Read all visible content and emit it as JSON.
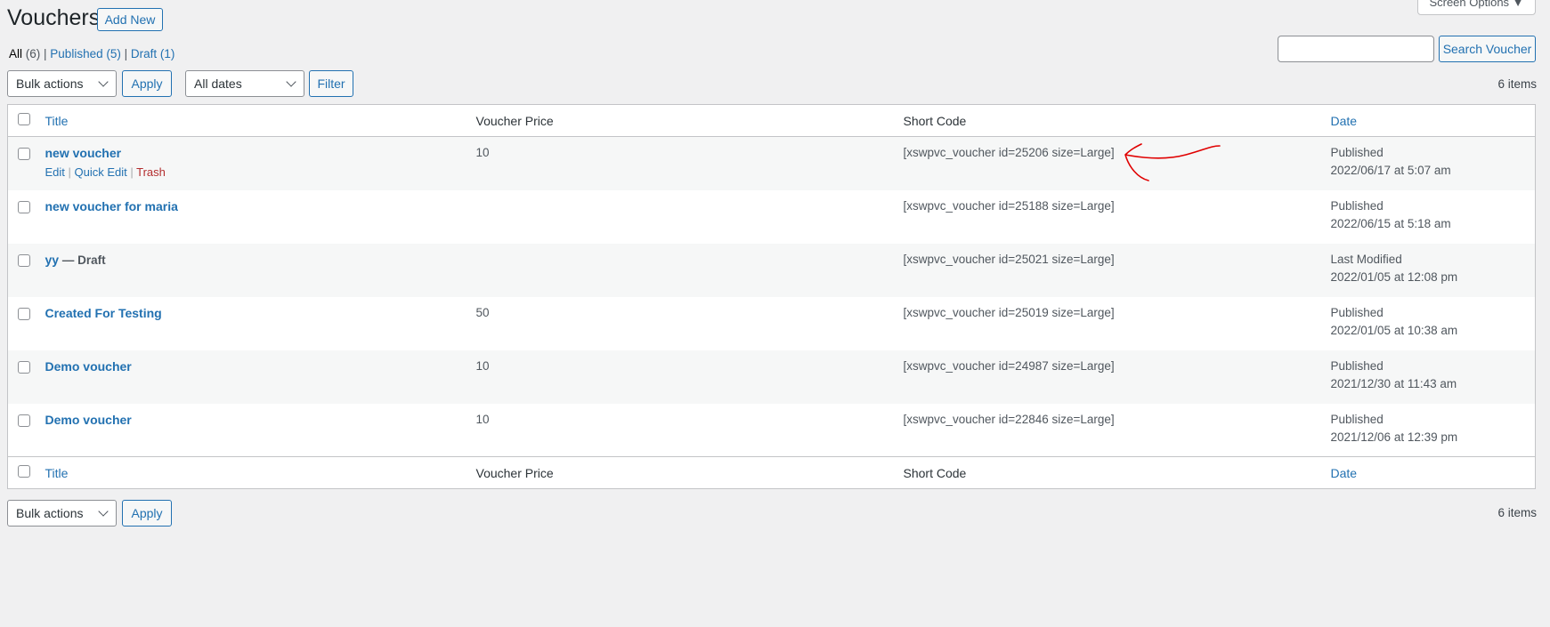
{
  "header": {
    "title": "Vouchers",
    "add_new": "Add New",
    "screen_options": "Screen Options ▼"
  },
  "views": [
    {
      "label": "All",
      "count": "(6)",
      "current": true
    },
    {
      "label": "Published",
      "count": "(5)"
    },
    {
      "label": "Draft",
      "count": "(1)"
    }
  ],
  "search": {
    "value": "",
    "button": "Search Voucher"
  },
  "toolbar": {
    "bulk_actions": "Bulk actions",
    "apply": "Apply",
    "dates": "All dates",
    "filter": "Filter",
    "items": "6 items"
  },
  "columns": {
    "title": "Title",
    "price": "Voucher Price",
    "shortcode": "Short Code",
    "date": "Date"
  },
  "rows": [
    {
      "title": "new voucher",
      "price": "10",
      "shortcode": "[xswpvc_voucher id=25206 size=Large]",
      "status": "Published",
      "date": "2022/06/17 at 5:07 am",
      "actions": {
        "edit": "Edit",
        "quick_edit": "Quick Edit",
        "trash": "Trash"
      }
    },
    {
      "title": "new voucher for maria",
      "price": "",
      "shortcode": "[xswpvc_voucher id=25188 size=Large]",
      "status": "Published",
      "date": "2022/06/15 at 5:18 am"
    },
    {
      "title": "yy",
      "state": "— Draft",
      "price": "",
      "shortcode": "[xswpvc_voucher id=25021 size=Large]",
      "status": "Last Modified",
      "date": "2022/01/05 at 12:08 pm"
    },
    {
      "title": "Created For Testing",
      "price": "50",
      "shortcode": "[xswpvc_voucher id=25019 size=Large]",
      "status": "Published",
      "date": "2022/01/05 at 10:38 am"
    },
    {
      "title": "Demo voucher",
      "price": "10",
      "shortcode": "[xswpvc_voucher id=24987 size=Large]",
      "status": "Published",
      "date": "2021/12/30 at 11:43 am"
    },
    {
      "title": "Demo voucher",
      "price": "10",
      "shortcode": "[xswpvc_voucher id=22846 size=Large]",
      "status": "Published",
      "date": "2021/12/06 at 12:39 pm"
    }
  ],
  "annotation_color": "#e00000"
}
